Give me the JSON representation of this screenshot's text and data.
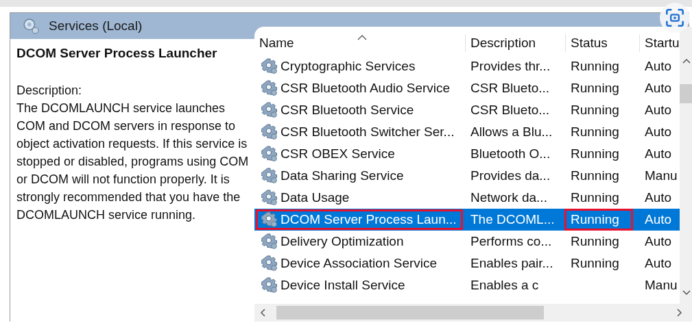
{
  "header": {
    "title": "Services (Local)"
  },
  "detail": {
    "service_name": "DCOM Server Process Launcher",
    "description_label": "Description:",
    "description": "The DCOMLAUNCH service launches COM and DCOM servers in response to object activation requests. If this service is stopped or disabled, programs using COM or DCOM will not function properly. It is strongly recommended that you have the DCOMLAUNCH service running."
  },
  "table": {
    "columns": [
      "Name",
      "Description",
      "Status",
      "Startu"
    ],
    "rows": [
      {
        "name": "Cryptographic Services",
        "description": "Provides thr...",
        "status": "Running",
        "startup": "Auto",
        "selected": false,
        "name_marked": false,
        "status_marked": false
      },
      {
        "name": "CSR Bluetooth Audio Service",
        "description": "CSR Blueto...",
        "status": "Running",
        "startup": "Auto",
        "selected": false,
        "name_marked": false,
        "status_marked": false
      },
      {
        "name": "CSR Bluetooth Service",
        "description": "CSR Blueto...",
        "status": "Running",
        "startup": "Auto",
        "selected": false,
        "name_marked": false,
        "status_marked": false
      },
      {
        "name": "CSR Bluetooth Switcher Ser...",
        "description": "Allows a Blu...",
        "status": "Running",
        "startup": "Auto",
        "selected": false,
        "name_marked": false,
        "status_marked": false
      },
      {
        "name": "CSR OBEX Service",
        "description": "Bluetooth O...",
        "status": "Running",
        "startup": "Auto",
        "selected": false,
        "name_marked": false,
        "status_marked": false
      },
      {
        "name": "Data Sharing Service",
        "description": "Provides da...",
        "status": "Running",
        "startup": "Manu",
        "selected": false,
        "name_marked": false,
        "status_marked": false
      },
      {
        "name": "Data Usage",
        "description": "Network da...",
        "status": "Running",
        "startup": "Auto",
        "selected": false,
        "name_marked": false,
        "status_marked": false
      },
      {
        "name": "DCOM Server Process Laun...",
        "description": "The DCOML...",
        "status": "Running",
        "startup": "Auto",
        "selected": true,
        "name_marked": true,
        "status_marked": true
      },
      {
        "name": "Delivery Optimization",
        "description": "Performs co...",
        "status": "Running",
        "startup": "Auto",
        "selected": false,
        "name_marked": false,
        "status_marked": false
      },
      {
        "name": "Device Association Service",
        "description": "Enables pair...",
        "status": "Running",
        "startup": "Auto",
        "selected": false,
        "name_marked": false,
        "status_marked": false
      },
      {
        "name": "Device Install Service",
        "description": "Enables a c",
        "startup": "Manu",
        "selected": false,
        "name_marked": false,
        "status_marked": false
      }
    ]
  }
}
